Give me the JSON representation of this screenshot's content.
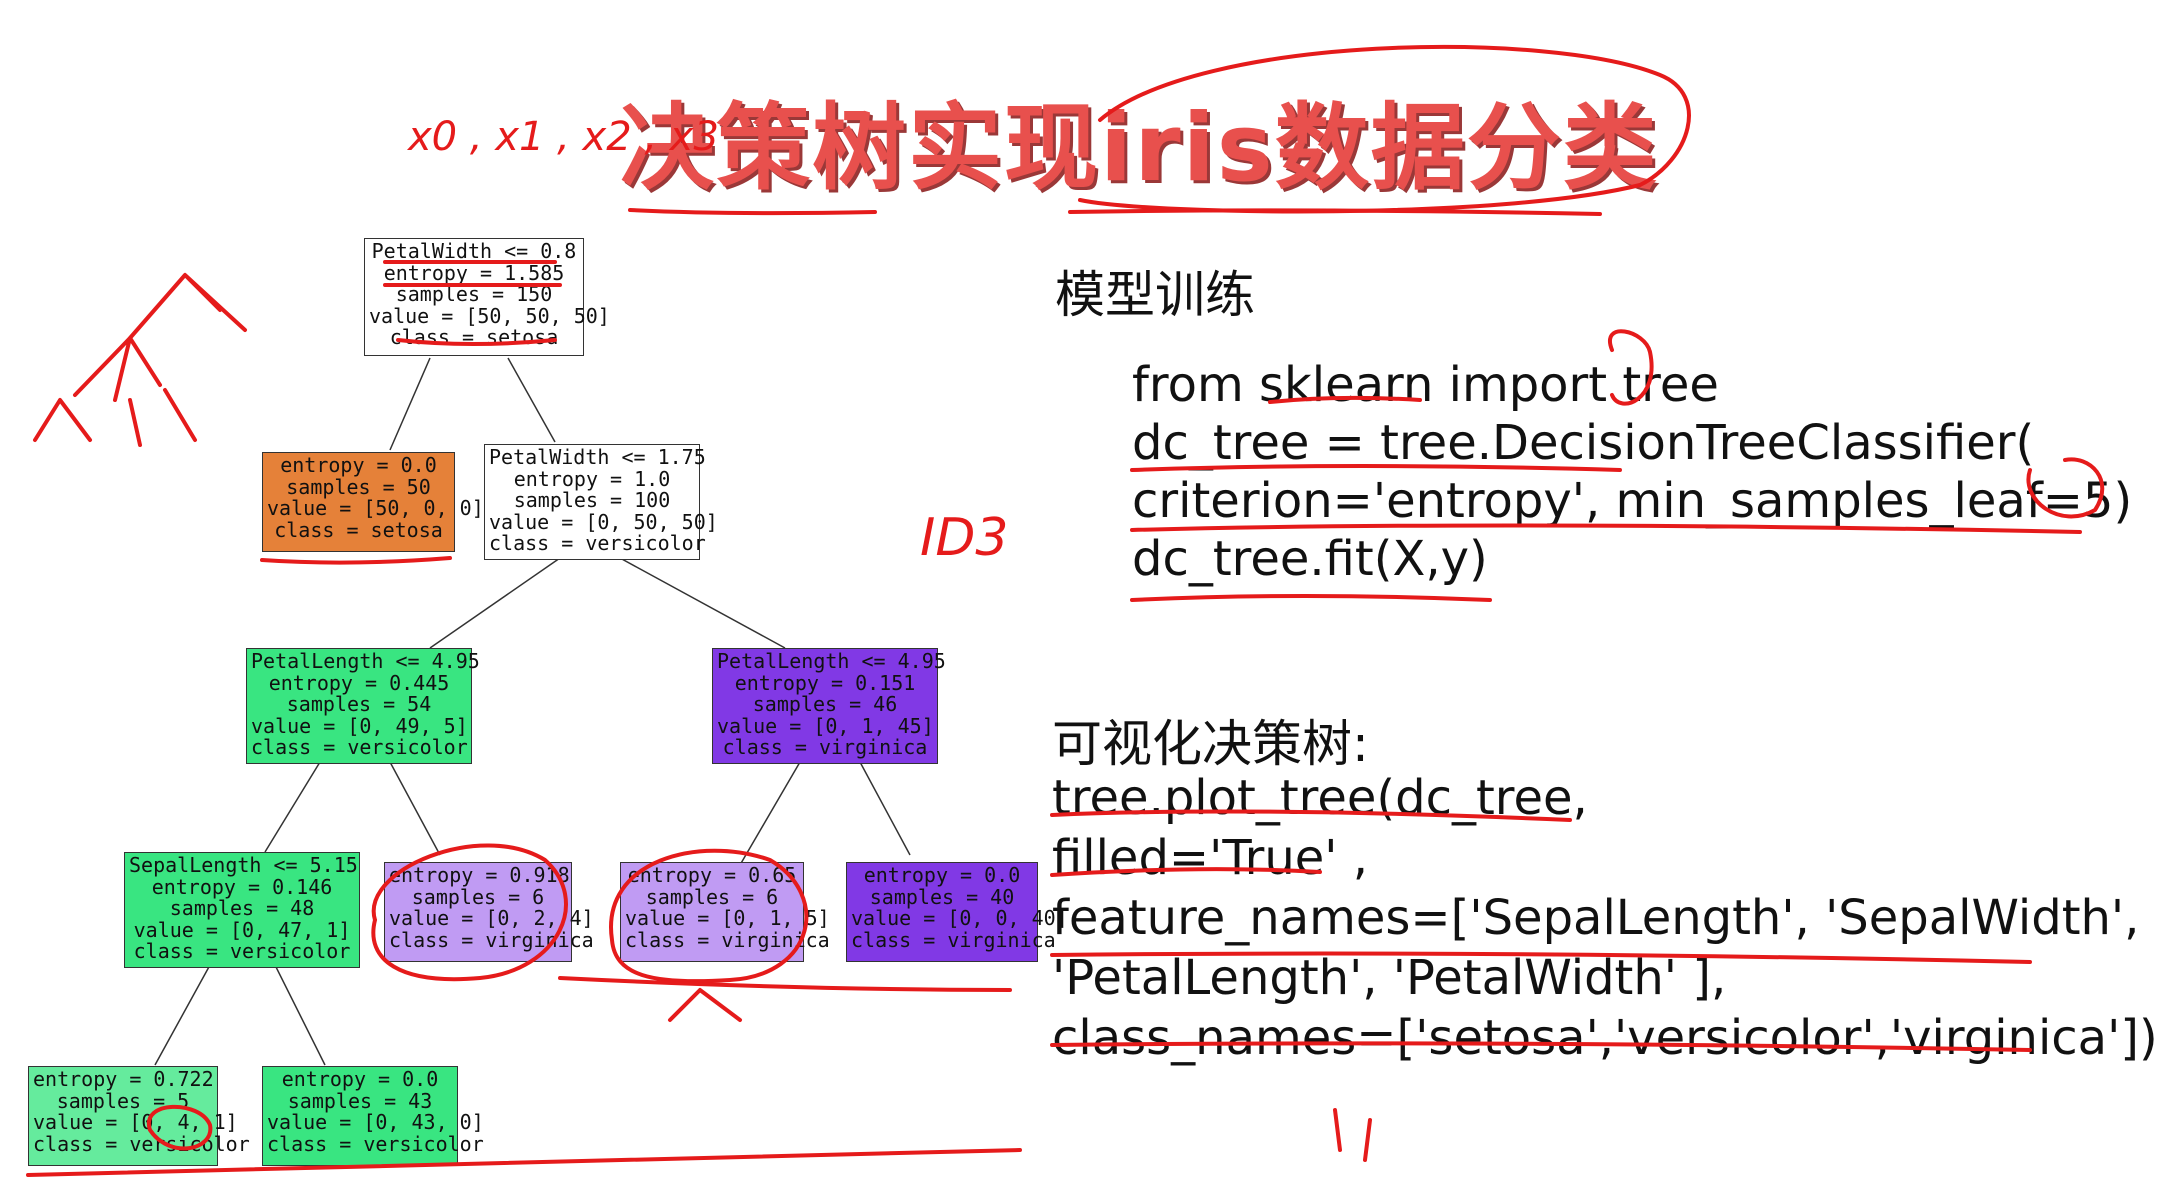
{
  "title": "决策树实现iris数据分类",
  "tree": {
    "nodes": [
      {
        "lines": [
          "PetalWidth <= 0.8",
          "entropy = 1.585",
          "samples = 150",
          "value = [50, 50, 50]",
          "class = setosa"
        ]
      },
      {
        "lines": [
          "entropy = 0.0",
          "samples = 50",
          "value = [50, 0, 0]",
          "class = setosa"
        ]
      },
      {
        "lines": [
          "PetalWidth <= 1.75",
          "entropy = 1.0",
          "samples = 100",
          "value = [0, 50, 50]",
          "class = versicolor"
        ]
      },
      {
        "lines": [
          "PetalLength <= 4.95",
          "entropy = 0.445",
          "samples = 54",
          "value = [0, 49, 5]",
          "class = versicolor"
        ]
      },
      {
        "lines": [
          "PetalLength <= 4.95",
          "entropy = 0.151",
          "samples = 46",
          "value = [0, 1, 45]",
          "class = virginica"
        ]
      },
      {
        "lines": [
          "SepalLength <= 5.15",
          "entropy = 0.146",
          "samples = 48",
          "value = [0, 47, 1]",
          "class = versicolor"
        ]
      },
      {
        "lines": [
          "entropy = 0.918",
          "samples = 6",
          "value = [0, 2, 4]",
          "class = virginica"
        ]
      },
      {
        "lines": [
          "entropy = 0.65",
          "samples = 6",
          "value = [0, 1, 5]",
          "class = virginica"
        ]
      },
      {
        "lines": [
          "entropy = 0.0",
          "samples = 40",
          "value = [0, 0, 40]",
          "class = virginica"
        ]
      },
      {
        "lines": [
          "entropy = 0.722",
          "samples = 5",
          "value = [0, 4, 1]",
          "class = versicolor"
        ]
      },
      {
        "lines": [
          "entropy = 0.0",
          "samples = 43",
          "value = [0, 43, 0]",
          "class = versicolor"
        ]
      }
    ]
  },
  "training": {
    "heading": "模型训练",
    "lines": [
      "from sklearn import tree",
      "dc_tree = tree.DecisionTreeClassifier(",
      "criterion='entropy', min_samples_leaf=5)",
      "dc_tree.fit(X,y)"
    ]
  },
  "visualize": {
    "heading": "可视化决策树:",
    "lines": [
      "tree.plot_tree(dc_tree,",
      "filled='True' ,",
      "feature_names=['SepalLength', 'SepalWidth',",
      "'PetalLength', 'PetalWidth' ],",
      "class_names=['setosa','versicolor','virginica'])"
    ]
  },
  "handwriting": {
    "top_left": "x0 , x1 , x2 , x3",
    "id3": "ID3"
  },
  "colors": {
    "title": "#e8504d",
    "annotation": "#e51b1b",
    "setosa": "#e58139",
    "versicolor": "#39e581",
    "virginica": "#8139e5"
  }
}
